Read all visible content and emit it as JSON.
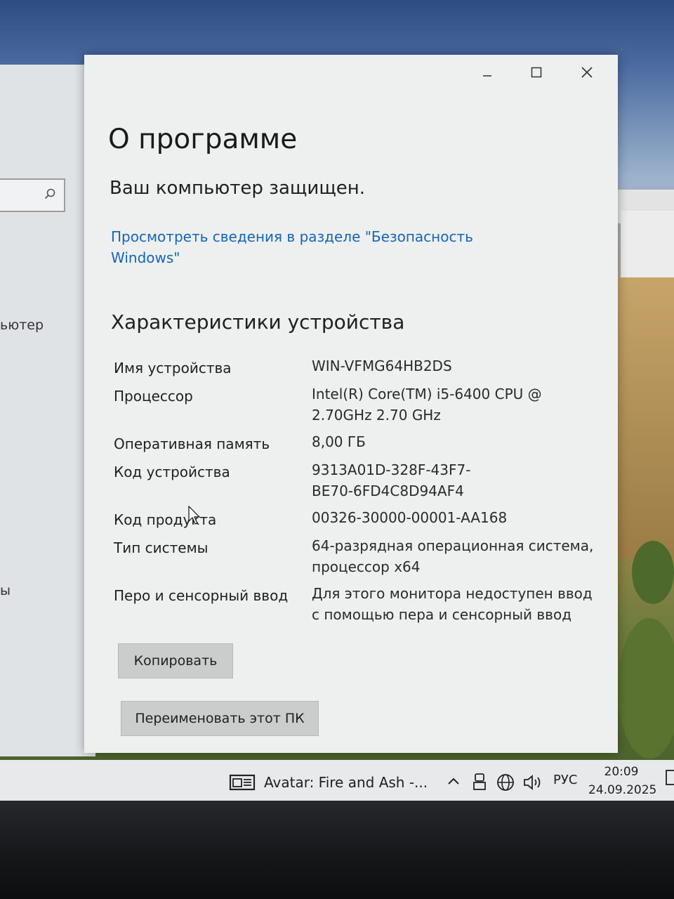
{
  "dialog": {
    "title": "О программе",
    "protected_status": "Ваш компьютер защищен.",
    "security_link": "Просмотреть сведения в разделе \"Безопасность Windows\"",
    "section_title": "Характеристики устройства",
    "controls": {
      "minimize": "–",
      "maximize": "☐",
      "close": "✕"
    },
    "specs": [
      {
        "label": "Имя устройства",
        "value": "WIN-VFMG64HB2DS"
      },
      {
        "label": "Процессор",
        "value": "Intel(R) Core(TM) i5-6400 CPU @ 2.70GHz   2.70 GHz"
      },
      {
        "label": "Оперативная память",
        "value": "8,00 ГБ"
      },
      {
        "label": "Код устройства",
        "value": "9313A01D-328F-43F7-BE70-6FD4C8D94AF4"
      },
      {
        "label": "Код продукта",
        "value": "00326-30000-00001-AA168"
      },
      {
        "label": "Тип системы",
        "value": "64-разрядная операционная система, процессор x64"
      },
      {
        "label": "Перо и сенсорный ввод",
        "value": "Для этого монитора недоступен ввод с помощью пера и сенсорный ввод"
      }
    ],
    "copy_button": "Копировать",
    "rename_button": "Переименовать этот ПК"
  },
  "settings": {
    "partial_text_1": "ьютер",
    "partial_text_2": "ы"
  },
  "taskbar": {
    "app_title": "Avatar: Fire and Ash -...",
    "language": "РУС",
    "time": "20:09",
    "date": "24.09.2025"
  }
}
